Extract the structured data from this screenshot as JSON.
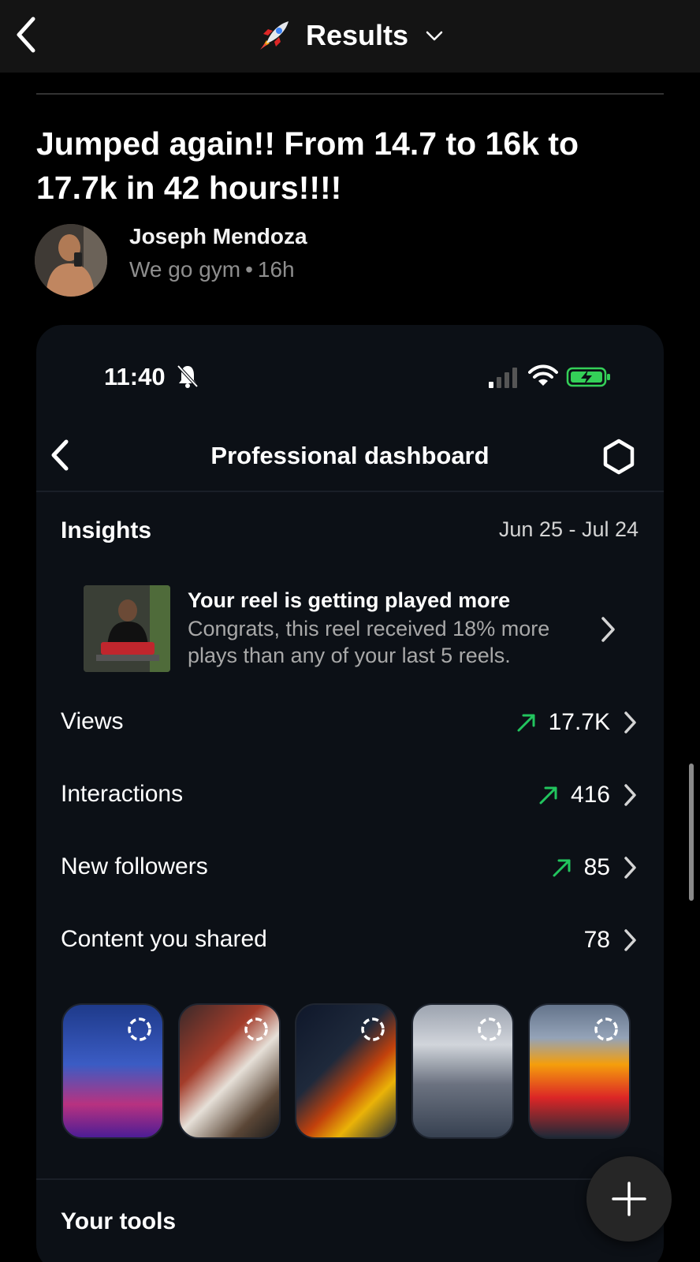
{
  "header": {
    "title": "Results",
    "back_icon": "chevron-left-icon",
    "emoji_icon": "rocket-icon",
    "dropdown_icon": "chevron-down-icon"
  },
  "post": {
    "title": "Jumped again!! From 14.7 to 16k to 17.7k in 42 hours!!!!",
    "author": "Joseph Mendoza",
    "group": "We go gym",
    "separator": "•",
    "age": "16h"
  },
  "screenshot": {
    "status_bar": {
      "time": "11:40"
    },
    "nav": {
      "title": "Professional dashboard"
    },
    "insights": {
      "heading": "Insights",
      "date_range": "Jun 25 - Jul 24",
      "reel_card": {
        "headline": "Your reel is getting played more",
        "body": "Congrats, this reel received 18% more plays than any of your last 5 reels."
      },
      "metrics": [
        {
          "label": "Views",
          "value": "17.7K",
          "trend": "up"
        },
        {
          "label": "Interactions",
          "value": "416",
          "trend": "up"
        },
        {
          "label": "New followers",
          "value": "85",
          "trend": "up"
        },
        {
          "label": "Content you shared",
          "value": "78",
          "trend": "none"
        }
      ]
    },
    "tools_heading": "Your tools"
  },
  "colors": {
    "background": "#000000",
    "header_bg": "#141414",
    "card_bg": "#0c1016",
    "trend_up": "#22c55e",
    "muted_text": "#8e8e8e",
    "battery_charge": "#34d058"
  },
  "fab": {
    "icon": "plus-icon"
  }
}
